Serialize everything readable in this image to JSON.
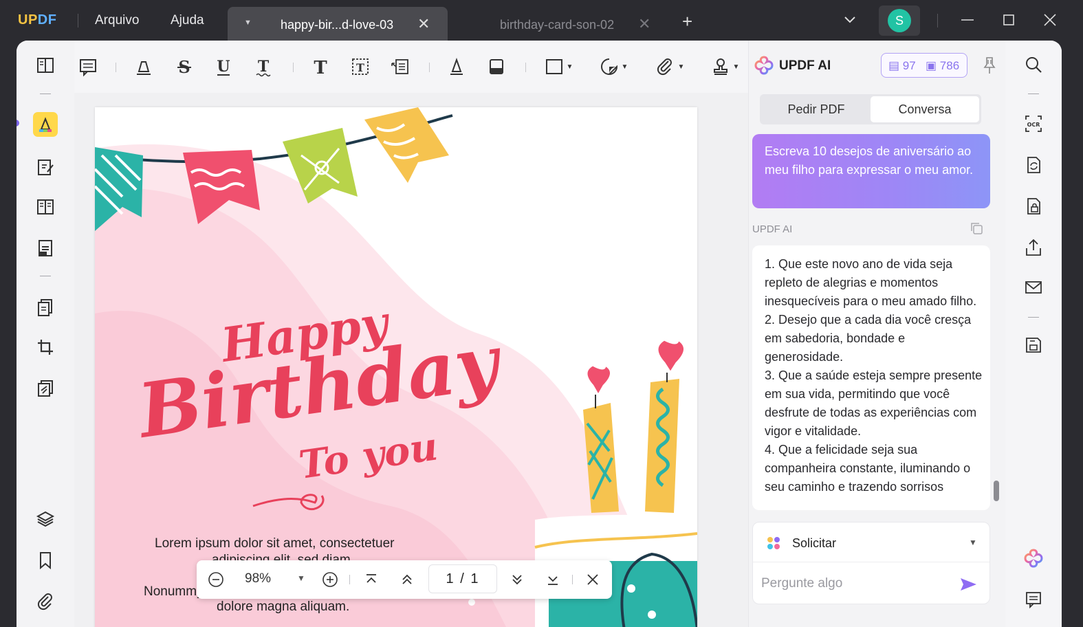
{
  "app": {
    "logo": "UPDF",
    "menu": [
      "Arquivo",
      "Ajuda"
    ],
    "tabs": [
      {
        "label": "happy-bir...d-love-03",
        "active": true
      },
      {
        "label": "birthday-card-son-02",
        "active": false
      }
    ],
    "user_initial": "S",
    "colors": {
      "accent": "#7a64e8",
      "avatar": "#22c3a4",
      "highlight_yellow": "#ffd84a",
      "prompt_gradient_start": "#b27cf3",
      "prompt_gradient_end": "#8d95f7"
    }
  },
  "document": {
    "body_line1": "Lorem ipsum dolor sit amet, consectetuer",
    "body_line2": "adipiscing elit, sed diam",
    "body_line3": "Nonummy",
    "body_line4": "dolore magna aliquam."
  },
  "zoom_bar": {
    "zoom": "98%",
    "page": "1 / 1"
  },
  "ai_panel": {
    "title": "UPDF AI",
    "quota_pages": "97",
    "quota_messages": "786",
    "tabs": [
      "Pedir PDF",
      "Conversa"
    ],
    "active_tab": "Conversa",
    "prompt": "Escreva 10 desejos de aniversário ao meu filho para expressar o meu amor.",
    "source_label": "UPDF AI",
    "answer": [
      "1. Que este novo ano de vida seja repleto de alegrias e momentos inesquecíveis para o meu amado filho.",
      "2. Desejo que a cada dia você cresça em sabedoria, bondade e generosidade.",
      "3. Que a saúde esteja sempre presente em sua vida, permitindo que você desfrute de todas as experiências com vigor e vitalidade.",
      "4. Que a felicidade seja sua companheira constante, iluminando o seu caminho e trazendo sorrisos"
    ],
    "request_mode": "Solicitar",
    "input_placeholder": "Pergunte algo"
  }
}
